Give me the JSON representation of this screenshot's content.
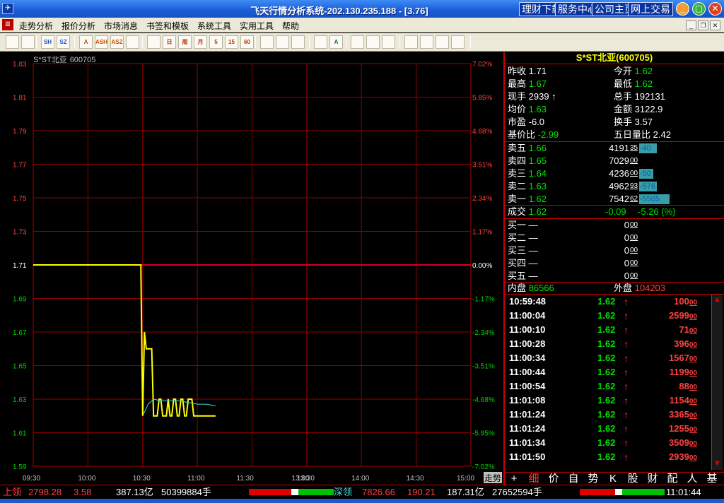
{
  "window": {
    "title": "飞天行情分析系统-202.130.235.188 - [3.76]",
    "links": [
      "理财下载",
      "服务中心",
      "公司主页",
      "网上交易"
    ]
  },
  "menu": [
    "走势分析",
    "报价分析",
    "市场消息",
    "书签和模板",
    "系统工具",
    "实用工具",
    "帮助"
  ],
  "toolbar": {
    "icons": [
      "back-icon",
      "window-icon",
      "sh-index-icon",
      "sz-index-icon",
      "a-share-icon",
      "ash-icon",
      "asz-icon",
      "checklist-icon",
      "trend-icon",
      "day-k-icon",
      "week-k-icon",
      "month-k-icon",
      "5min-icon",
      "15min-icon",
      "60min-icon",
      "arrow-icon",
      "zoom-icon",
      "bar-icon",
      "grid-icon",
      "a-icon",
      "stock-a-icon",
      "stock-b-icon",
      "stock-c-icon",
      "book-icon",
      "notepad-icon",
      "calc-icon",
      "camera-icon"
    ],
    "labels": [
      "",
      "",
      "SH",
      "SZ",
      "A",
      "ASH",
      "ASZ",
      "",
      "",
      "日",
      "周",
      "月",
      "5",
      "15",
      "60",
      "",
      "",
      "",
      "",
      "A",
      "",
      "",
      "",
      "",
      "",
      "",
      ""
    ]
  },
  "chart": {
    "name": "S*ST北亚",
    "code": "600705",
    "y_ticks": [
      "1.83",
      "1.81",
      "1.79",
      "1.77",
      "1.75",
      "1.73",
      "1.71",
      "1.69",
      "1.67",
      "1.65",
      "1.63",
      "1.61",
      "1.59"
    ],
    "pct_ticks": [
      "7.02%",
      "5.85%",
      "4.68%",
      "3.51%",
      "2.34%",
      "1.17%",
      "0.00%",
      "-1.17%",
      "-2.34%",
      "-3.51%",
      "-4.68%",
      "-5.85%",
      "-7.02%"
    ],
    "x_ticks": [
      "09:30",
      "10:00",
      "10:30",
      "11:00",
      "11:30",
      "13:00",
      "13:30",
      "14:00",
      "14:30",
      "15:00"
    ],
    "corner_label": "走势"
  },
  "chart_data": {
    "type": "line",
    "prev_close": 1.71,
    "ylim": [
      1.59,
      1.83
    ],
    "x_ticks": [
      "09:30",
      "10:00",
      "10:30",
      "11:00",
      "11:30",
      "13:00",
      "13:30",
      "14:00",
      "14:30",
      "15:00"
    ],
    "series": [
      {
        "color": "#ffff00",
        "minutes": [
          0,
          59,
          60,
          61,
          62,
          63,
          64,
          65,
          66,
          67,
          68,
          69,
          70,
          71,
          72,
          73,
          74,
          75,
          76,
          77,
          78,
          79,
          80,
          81,
          82,
          83,
          84,
          85,
          86,
          87,
          88,
          89,
          90,
          91,
          92,
          93,
          94,
          95,
          96,
          97,
          98,
          99,
          100
        ],
        "values": [
          1.71,
          1.71,
          1.62,
          1.67,
          1.66,
          1.66,
          1.66,
          1.66,
          1.62,
          1.62,
          1.62,
          1.63,
          1.63,
          1.62,
          1.62,
          1.62,
          1.63,
          1.62,
          1.62,
          1.63,
          1.63,
          1.62,
          1.62,
          1.63,
          1.63,
          1.62,
          1.62,
          1.63,
          1.63,
          1.63,
          1.62,
          1.62,
          1.62,
          1.62,
          1.62,
          1.62,
          1.62,
          1.62,
          1.62,
          1.62,
          1.62,
          1.62,
          1.62
        ]
      },
      {
        "color": "#40e0e0",
        "minutes": [
          60,
          63,
          66,
          70,
          75,
          80,
          85,
          90,
          95,
          100
        ],
        "values": [
          1.62,
          1.627,
          1.63,
          1.629,
          1.629,
          1.629,
          1.628,
          1.627,
          1.627,
          1.626
        ]
      }
    ]
  },
  "quote": {
    "title": "S*ST北亚(600705)",
    "stats": [
      {
        "l1": "昨收",
        "v1": "1.71",
        "c1": "w",
        "l2": "今开",
        "v2": "1.62",
        "c2": "g"
      },
      {
        "l1": "最高",
        "v1": "1.67",
        "c1": "g",
        "l2": "最低",
        "v2": "1.62",
        "c2": "g"
      },
      {
        "l1": "现手",
        "v1": "2939 ↑",
        "c1": "w",
        "l2": "总手",
        "v2": "192131",
        "c2": "w"
      },
      {
        "l1": "均价",
        "v1": "1.63",
        "c1": "g",
        "l2": "金额",
        "v2": "3122.9",
        "c2": "w"
      },
      {
        "l1": "市盈",
        "v1": "-6.0",
        "c1": "w",
        "l2": "换手",
        "v2": "3.57",
        "c2": "w"
      },
      {
        "l1": "基价比",
        "v1": "-2.99",
        "c1": "g",
        "l2": "五日量比",
        "v2": "2.42",
        "c2": "w"
      }
    ],
    "asks": [
      {
        "label": "卖五",
        "price": "1.66",
        "vol": "4191",
        "sub": "35",
        "chg": "-40",
        "bar": 0.18
      },
      {
        "label": "卖四",
        "price": "1.65",
        "vol": "7029",
        "sub": "00",
        "chg": "",
        "bar": 0
      },
      {
        "label": "卖三",
        "price": "1.64",
        "vol": "4236",
        "sub": "00",
        "chg": "-50",
        "bar": 0.14
      },
      {
        "label": "卖二",
        "price": "1.63",
        "vol": "4962",
        "sub": "93",
        "chg": "-576",
        "bar": 0.18
      },
      {
        "label": "卖一",
        "price": "1.62",
        "vol": "7542",
        "sub": "62",
        "chg": "-5505",
        "bar": 0.31
      }
    ],
    "trade": {
      "label": "成交",
      "price": "1.62",
      "chg": "-0.09",
      "pct": "-5.26 (%)"
    },
    "bids": [
      {
        "label": "买一",
        "price": "—",
        "vol": "0",
        "sub": "00"
      },
      {
        "label": "买二",
        "price": "—",
        "vol": "0",
        "sub": "00"
      },
      {
        "label": "买三",
        "price": "—",
        "vol": "0",
        "sub": "00"
      },
      {
        "label": "买四",
        "price": "—",
        "vol": "0",
        "sub": "00"
      },
      {
        "label": "买五",
        "price": "—",
        "vol": "0",
        "sub": "00"
      }
    ],
    "inner": {
      "label": "内盘",
      "value": "86566"
    },
    "outer": {
      "label": "外盘",
      "value": "104203"
    },
    "ticks": [
      {
        "time": "10:59:48",
        "price": "1.62",
        "vol": "100",
        "sub": "00"
      },
      {
        "time": "11:00:04",
        "price": "1.62",
        "vol": "2599",
        "sub": "00"
      },
      {
        "time": "11:00:10",
        "price": "1.62",
        "vol": "71",
        "sub": "00"
      },
      {
        "time": "11:00:28",
        "price": "1.62",
        "vol": "396",
        "sub": "00"
      },
      {
        "time": "11:00:34",
        "price": "1.62",
        "vol": "1567",
        "sub": "00"
      },
      {
        "time": "11:00:44",
        "price": "1.62",
        "vol": "1199",
        "sub": "00"
      },
      {
        "time": "11:00:54",
        "price": "1.62",
        "vol": "88",
        "sub": "00"
      },
      {
        "time": "11:01:08",
        "price": "1.62",
        "vol": "1154",
        "sub": "00"
      },
      {
        "time": "11:01:24",
        "price": "1.62",
        "vol": "3365",
        "sub": "00"
      },
      {
        "time": "11:01:24",
        "price": "1.62",
        "vol": "1255",
        "sub": "00"
      },
      {
        "time": "11:01:34",
        "price": "1.62",
        "vol": "3509",
        "sub": "00"
      },
      {
        "time": "11:01:50",
        "price": "1.62",
        "vol": "2939",
        "sub": "00"
      }
    ],
    "tabs": [
      "+",
      "细",
      "价",
      "自",
      "势",
      "K",
      "股",
      "财",
      "配",
      "人",
      "基"
    ]
  },
  "status": {
    "sh_label": "上领",
    "sh_index": "2798.28",
    "sh_chg": "3.58",
    "sh_amount": "387.13亿",
    "sh_volume": "50399884手",
    "sz_label": "深领",
    "sz_index": "7826.66",
    "sz_chg": "190.21",
    "sz_amount": "187.31亿",
    "sz_volume": "27652594手",
    "time": "11:01:44"
  }
}
